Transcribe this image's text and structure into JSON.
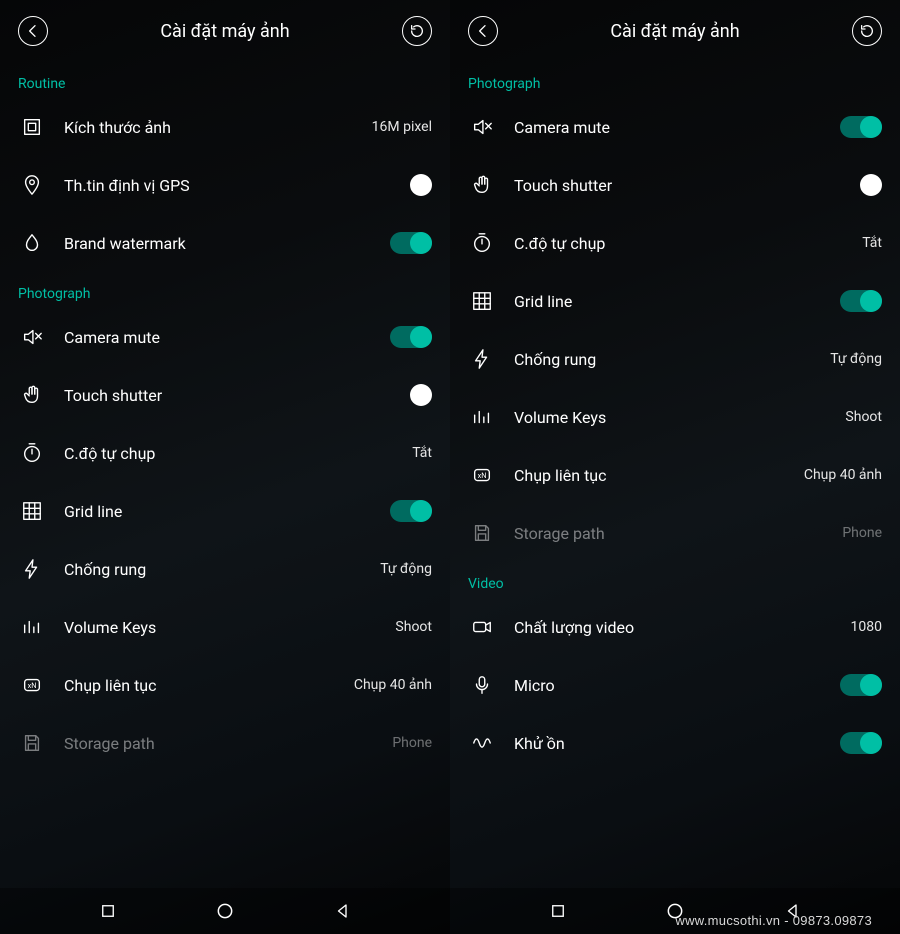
{
  "header": {
    "title": "Cài đặt máy ảnh"
  },
  "left": {
    "sections": [
      {
        "label": "Routine",
        "items": [
          {
            "name": "image-size",
            "icon": "crop",
            "label": "Kích thước ảnh",
            "value": "16M pixel",
            "type": "value"
          },
          {
            "name": "gps",
            "icon": "location",
            "label": "Th.tin định vị GPS",
            "type": "radio"
          },
          {
            "name": "watermark",
            "icon": "drop",
            "label": "Brand watermark",
            "type": "toggle",
            "on": true
          }
        ]
      },
      {
        "label": "Photograph",
        "items": [
          {
            "name": "camera-mute",
            "icon": "mute",
            "label": "Camera mute",
            "type": "toggle",
            "on": true
          },
          {
            "name": "touch-shutter",
            "icon": "hand",
            "label": "Touch shutter",
            "type": "radio"
          },
          {
            "name": "self-timer",
            "icon": "timer",
            "label": "C.độ tự chụp",
            "value": "Tắt",
            "type": "value"
          },
          {
            "name": "grid-line",
            "icon": "grid",
            "label": "Grid line",
            "type": "toggle",
            "on": true
          },
          {
            "name": "anti-shake",
            "icon": "flash",
            "label": "Chống rung",
            "value": "Tự động",
            "type": "value"
          },
          {
            "name": "volume-keys",
            "icon": "levels",
            "label": "Volume Keys",
            "value": "Shoot",
            "type": "value"
          },
          {
            "name": "burst",
            "icon": "burst",
            "label": "Chụp liên tục",
            "value": "Chụp 40 ảnh",
            "type": "value"
          },
          {
            "name": "storage",
            "icon": "save",
            "label": "Storage path",
            "value": "Phone",
            "type": "value",
            "disabled": true
          }
        ]
      }
    ]
  },
  "right": {
    "sections": [
      {
        "label": "Photograph",
        "items": [
          {
            "name": "camera-mute",
            "icon": "mute",
            "label": "Camera mute",
            "type": "toggle",
            "on": true
          },
          {
            "name": "touch-shutter",
            "icon": "hand",
            "label": "Touch shutter",
            "type": "radio"
          },
          {
            "name": "self-timer",
            "icon": "timer",
            "label": "C.độ tự chụp",
            "value": "Tắt",
            "type": "value"
          },
          {
            "name": "grid-line",
            "icon": "grid",
            "label": "Grid line",
            "type": "toggle",
            "on": true
          },
          {
            "name": "anti-shake",
            "icon": "flash",
            "label": "Chống rung",
            "value": "Tự động",
            "type": "value"
          },
          {
            "name": "volume-keys",
            "icon": "levels",
            "label": "Volume Keys",
            "value": "Shoot",
            "type": "value"
          },
          {
            "name": "burst",
            "icon": "burst",
            "label": "Chụp liên tục",
            "value": "Chụp 40 ảnh",
            "type": "value"
          },
          {
            "name": "storage",
            "icon": "save",
            "label": "Storage path",
            "value": "Phone",
            "type": "value",
            "disabled": true
          }
        ]
      },
      {
        "label": "Video",
        "items": [
          {
            "name": "video-quality",
            "icon": "video",
            "label": "Chất lượng video",
            "value": "1080",
            "type": "value"
          },
          {
            "name": "micro",
            "icon": "mic",
            "label": "Micro",
            "type": "toggle",
            "on": true
          },
          {
            "name": "noise-cancel",
            "icon": "wave",
            "label": "Khử ồn",
            "type": "toggle",
            "on": true
          }
        ]
      }
    ]
  },
  "watermark": "www.mucsothi.vn - 09873.09873"
}
